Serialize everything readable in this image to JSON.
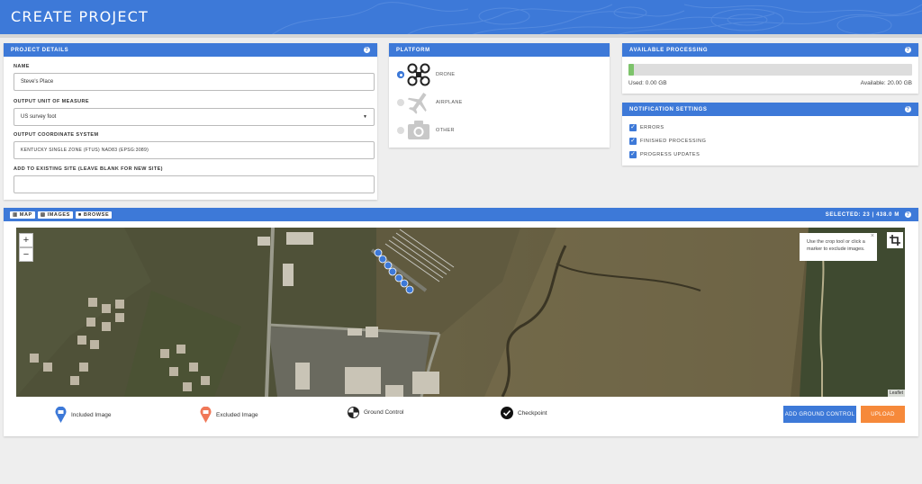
{
  "header": {
    "title": "CREATE PROJECT"
  },
  "project_details": {
    "title": "PROJECT DETAILS",
    "name_label": "NAME",
    "name_value": "Steve's Place",
    "unit_label": "OUTPUT UNIT OF MEASURE",
    "unit_value": "US survey foot",
    "coord_label": "OUTPUT COORDINATE SYSTEM",
    "coord_value": "KENTUCKY SINGLE ZONE (FTUS) NAD83 (EPSG:3089)",
    "site_label": "ADD TO EXISTING SITE (LEAVE BLANK FOR NEW SITE)",
    "site_value": ""
  },
  "platform": {
    "title": "PLATFORM",
    "options": [
      {
        "label": "DRONE",
        "icon": "drone-icon",
        "selected": true
      },
      {
        "label": "AIRPLANE",
        "icon": "airplane-icon",
        "selected": false
      },
      {
        "label": "OTHER",
        "icon": "camera-icon",
        "selected": false
      }
    ]
  },
  "processing": {
    "title": "AVAILABLE PROCESSING",
    "used": "Used: 0.00 GB",
    "available": "Available: 20.00 GB",
    "used_fraction": 0.02
  },
  "notifications": {
    "title": "NOTIFICATION SETTINGS",
    "items": [
      {
        "label": "ERRORS",
        "checked": true
      },
      {
        "label": "FINISHED PROCESSING",
        "checked": true
      },
      {
        "label": "PROGRESS UPDATES",
        "checked": true
      }
    ]
  },
  "map_panel": {
    "tabs": {
      "map": "MAP",
      "images": "IMAGES",
      "browse": "BROWSE"
    },
    "selected": "SELECTED: 23 | 438.0 M",
    "zoom_in": "+",
    "zoom_out": "−",
    "tooltip": "Use the crop tool or click a marker to exclude images.",
    "tooltip_close": "×",
    "attribution": "Leaflet"
  },
  "legend": {
    "included": "Included Image",
    "excluded": "Excluded Image",
    "ground_control": "Ground Control",
    "checkpoint": "Checkpoint"
  },
  "actions": {
    "add_ground_control": "ADD GROUND CONTROL",
    "upload": "UPLOAD"
  },
  "colors": {
    "primary": "#3d79d8",
    "upload": "#f6893a",
    "progress": "#7dc36b",
    "excluded": "#f07858"
  }
}
